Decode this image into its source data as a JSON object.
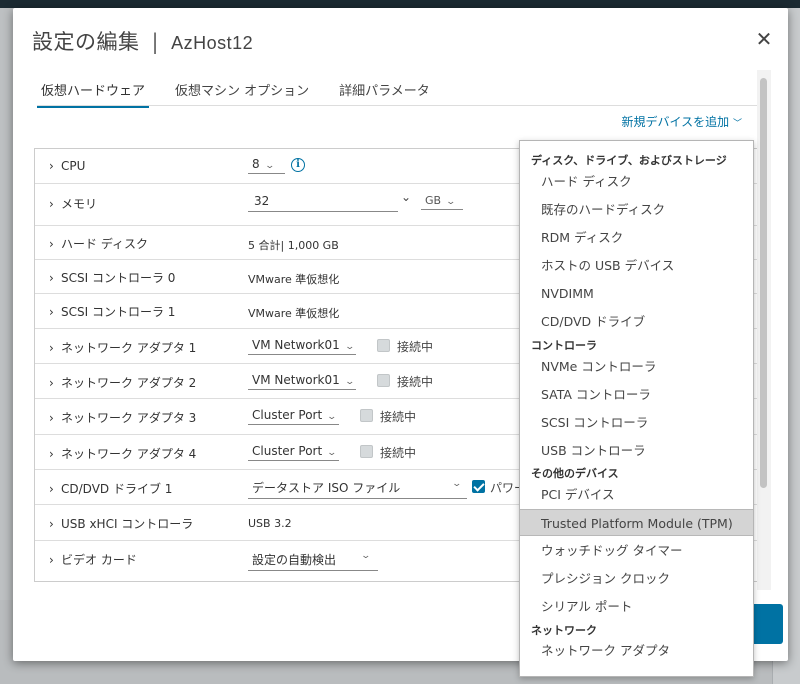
{
  "dialog": {
    "title": "設定の編集",
    "separator": "|",
    "host": "AzHost12",
    "close_glyph": "✕"
  },
  "tabs": [
    {
      "label": "仮想ハードウェア",
      "active": true
    },
    {
      "label": "仮想マシン オプション",
      "active": false
    },
    {
      "label": "詳細パラメータ",
      "active": false
    }
  ],
  "add_device_label": "新規デバイスを追加",
  "hardware": {
    "cpu": {
      "label": "CPU",
      "value": "8"
    },
    "memory": {
      "label": "メモリ",
      "value": "32",
      "unit": "GB"
    },
    "hard_disk": {
      "label": "ハード ディスク",
      "value": "5 合計| 1,000 GB"
    },
    "scsi0": {
      "label": "SCSI コントローラ 0",
      "value": "VMware 準仮想化"
    },
    "scsi1": {
      "label": "SCSI コントローラ 1",
      "value": "VMware 準仮想化"
    },
    "net1": {
      "label": "ネットワーク アダプタ 1",
      "value": "VM Network01",
      "connect": "接続中"
    },
    "net2": {
      "label": "ネットワーク アダプタ 2",
      "value": "VM Network01",
      "connect": "接続中"
    },
    "net3": {
      "label": "ネットワーク アダプタ 3",
      "value": "Cluster Port",
      "connect": "接続中"
    },
    "net4": {
      "label": "ネットワーク アダプタ 4",
      "value": "Cluster Port",
      "connect": "接続中"
    },
    "cddvd": {
      "label": "CD/DVD ドライブ 1",
      "value": "データストア ISO ファイル",
      "power": "パワー"
    },
    "usb": {
      "label": "USB xHCI コントローラ",
      "value": "USB 3.2"
    },
    "video": {
      "label": "ビデオ カード",
      "value": "設定の自動検出"
    }
  },
  "menu": {
    "group1": "ディスク、ドライブ、およびストレージ",
    "group1_items": [
      "ハード ディスク",
      "既存のハードディスク",
      "RDM ディスク",
      "ホストの USB デバイス",
      "NVDIMM",
      "CD/DVD ドライブ"
    ],
    "group2": "コントローラ",
    "group2_items": [
      "NVMe コントローラ",
      "SATA コントローラ",
      "SCSI コントローラ",
      "USB コントローラ"
    ],
    "group3": "その他のデバイス",
    "group3_items": [
      "PCI デバイス",
      "Trusted Platform Module (TPM)",
      "ウォッチドッグ タイマー",
      "プレシジョン クロック",
      "シリアル ポート"
    ],
    "group4": "ネットワーク",
    "group4_items": [
      "ネットワーク アダプタ"
    ],
    "selected": "Trusted Platform Module (TPM)"
  },
  "colors": {
    "accent": "#0072a3",
    "selected_bg": "#d4d4d4"
  }
}
